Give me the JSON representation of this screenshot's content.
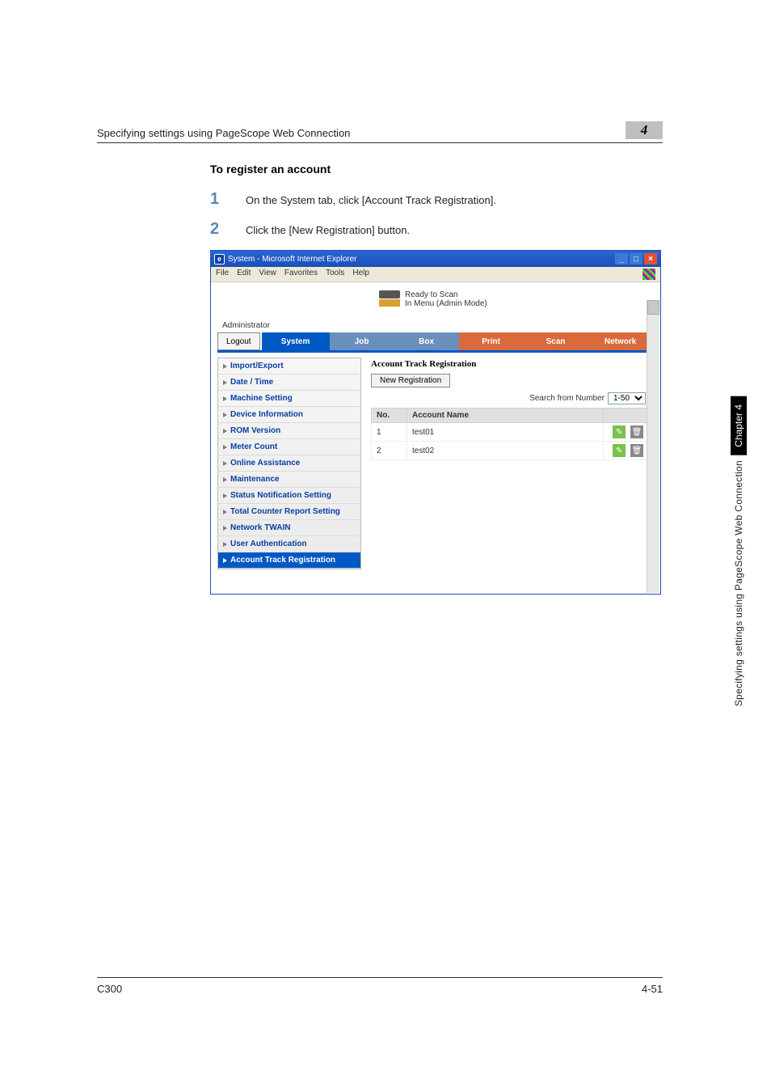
{
  "header": {
    "title": "Specifying settings using PageScope Web Connection",
    "chapter_num": "4"
  },
  "section_title": "To register an account",
  "steps": [
    {
      "num": "1",
      "text": "On the System tab, click [Account Track Registration]."
    },
    {
      "num": "2",
      "text": "Click the [New Registration] button."
    }
  ],
  "ie": {
    "title": "System - Microsoft Internet Explorer",
    "menu": [
      "File",
      "Edit",
      "View",
      "Favorites",
      "Tools",
      "Help"
    ],
    "min": "_",
    "max": "□",
    "close": "×"
  },
  "status": {
    "line1": "Ready to Scan",
    "line2": "In Menu (Admin Mode)"
  },
  "role": "Administrator",
  "tabs": {
    "logout": "Logout",
    "system": "System",
    "job": "Job",
    "box": "Box",
    "print": "Print",
    "scan": "Scan",
    "network": "Network"
  },
  "sidebar": [
    "Import/Export",
    "Date / Time",
    "Machine Setting",
    "Device Information",
    "ROM Version",
    "Meter Count",
    "Online Assistance",
    "Maintenance",
    "Status Notification Setting",
    "Total Counter Report Setting",
    "Network TWAIN",
    "User Authentication",
    "Account Track Registration"
  ],
  "main": {
    "title": "Account Track Registration",
    "new_registration": "New Registration",
    "search_label": "Search from Number",
    "range_option": "1-50",
    "col_no": "No.",
    "col_name": "Account Name",
    "rows": [
      {
        "no": "1",
        "name": "test01"
      },
      {
        "no": "2",
        "name": "test02"
      }
    ],
    "edit_glyph": "✎",
    "del_glyph": "🗑"
  },
  "side_tab": {
    "chapter": "Chapter 4",
    "text": "Specifying settings using PageScope Web Connection"
  },
  "footer": {
    "left": "C300",
    "right": "4-51"
  }
}
